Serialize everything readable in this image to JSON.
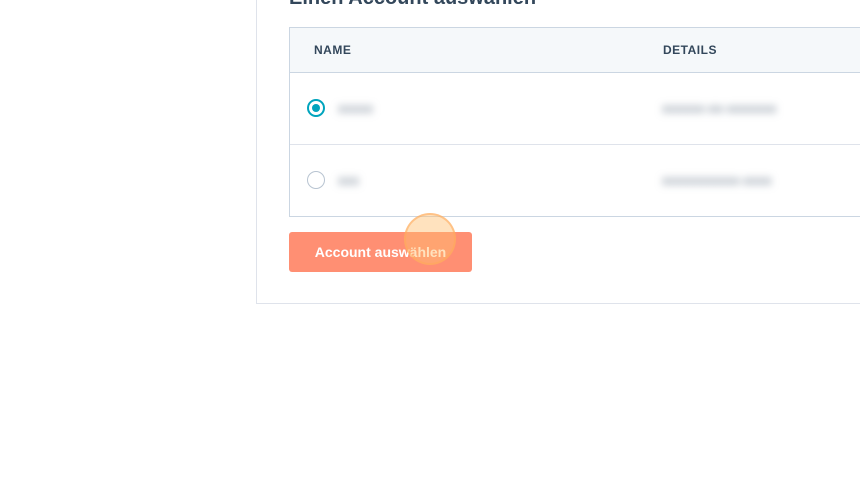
{
  "section": {
    "heading": "Einen Account auswählen"
  },
  "table": {
    "columns": {
      "name": "NAME",
      "details": "DETAILS"
    },
    "rows": [
      {
        "selected": true,
        "name": "xxxxx",
        "details": "xxxxxx-xx-xxxxxxx"
      },
      {
        "selected": false,
        "name": "xxx",
        "details": "xxxxxxxxxxx-xxxx"
      }
    ]
  },
  "actions": {
    "select_account_label": "Account auswählen"
  },
  "colors": {
    "primary_button": "#ff8f73",
    "radio_checked": "#00a4bd",
    "table_header_bg": "#f5f8fa",
    "text": "#33475b"
  }
}
